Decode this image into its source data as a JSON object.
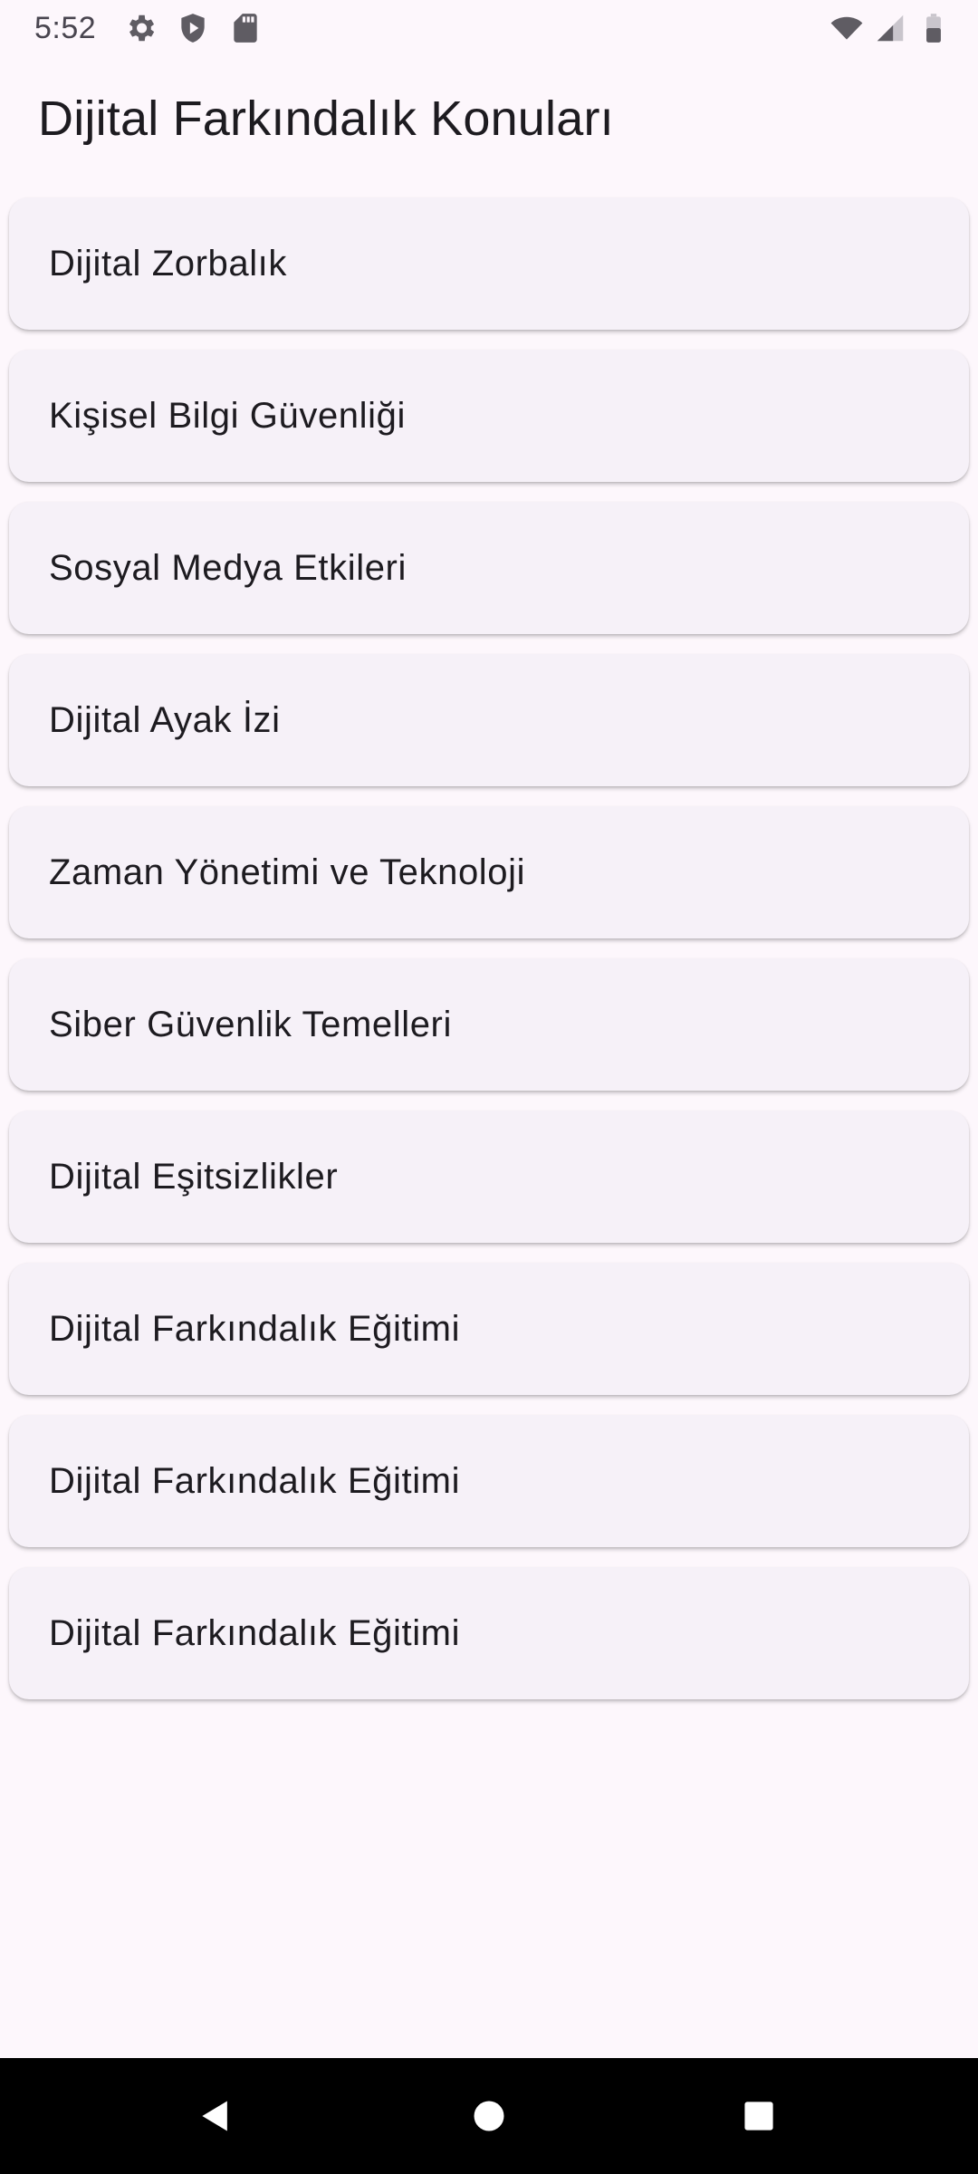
{
  "status_bar": {
    "time": "5:52",
    "left_icons": [
      "settings-icon",
      "shield-icon",
      "sd-card-icon"
    ],
    "right_icons": [
      "wifi-icon",
      "signal-icon",
      "battery-icon"
    ]
  },
  "header": {
    "title": "Dijital Farkındalık Konuları"
  },
  "topics": [
    "Dijital Zorbalık",
    "Kişisel Bilgi Güvenliği",
    "Sosyal Medya Etkileri",
    "Dijital Ayak İzi",
    "Zaman Yönetimi ve Teknoloji",
    "Siber Güvenlik Temelleri",
    "Dijital Eşitsizlikler",
    "Dijital Farkındalık Eğitimi",
    "Dijital Farkındalık Eğitimi",
    "Dijital Farkındalık Eğitimi"
  ],
  "navigation_bar": {
    "icons": [
      "back-icon",
      "home-icon",
      "recents-icon"
    ]
  },
  "colors": {
    "background": "#fdf7fc",
    "card": "#f6f1f8",
    "text": "#1d1b20",
    "nav_bar": "#000000"
  }
}
